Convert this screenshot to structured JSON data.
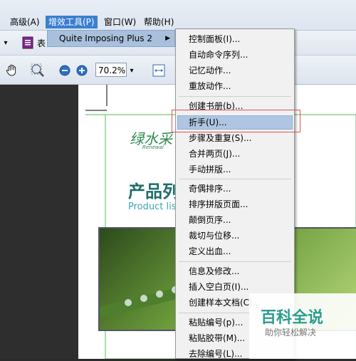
{
  "menubar": {
    "items": [
      {
        "label": "高级(A)",
        "active": false
      },
      {
        "label": "增效工具(P)",
        "active": true
      },
      {
        "label": "窗口(W)",
        "active": false
      },
      {
        "label": "帮助(H)",
        "active": false
      }
    ]
  },
  "toolbar": {
    "zoom_value": "70.2%"
  },
  "submenu": {
    "label": "Quite Imposing Plus 2",
    "arrow": "▶"
  },
  "menu": {
    "items": [
      "控制面板(I)...",
      "自动命令序列...",
      "记忆动作...",
      "重放动作...",
      "创建书册(b)...",
      "折手(U)...",
      "步骤及重复(S)...",
      "合并两页(J)...",
      "手动拼版...",
      "奇偶排序...",
      "排序拼版页面...",
      "颠倒页序...",
      "裁切与位移...",
      "定义出血...",
      "信息及修改...",
      "插入空白页(I)...",
      "创建样本文档(C)...",
      "粘贴编号(p)...",
      "粘贴胶带(M)...",
      "去除编号(L)..."
    ],
    "highlighted_index": 5
  },
  "document": {
    "logo_text": "绿水采",
    "logo_sub": "Renewal",
    "title": "产品列",
    "subtitle": "Product lis"
  },
  "watermark": {
    "title": "百科全说",
    "subtitle": "助你轻松解决"
  },
  "colors": {
    "accent": "#3a7fd0",
    "highlight": "#aec6e2",
    "teal_text": "#1e6d6a",
    "red_box": "#e0524f"
  }
}
